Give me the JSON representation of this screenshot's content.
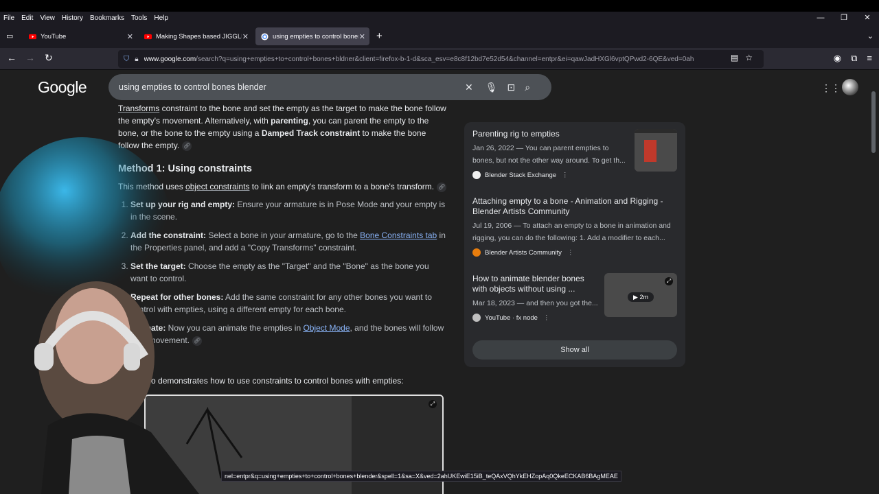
{
  "menu": [
    "File",
    "Edit",
    "View",
    "History",
    "Bookmarks",
    "Tools",
    "Help"
  ],
  "tabs": [
    {
      "label": "YouTube",
      "icon": "youtube-icon"
    },
    {
      "label": "Making Shapes based JIGGLE C",
      "icon": "youtube-icon"
    },
    {
      "label": "using empties to control bones",
      "icon": "google-icon"
    }
  ],
  "url": {
    "domain": "www.google.com",
    "rest": "/search?q=using+empties+to+control+bones+bldner&client=firefox-b-1-d&sca_esv=e8c8f12bd7e52d54&channel=entpr&ei=qawJadHXGl6vptQPwd2-6QE&ved=0ah"
  },
  "google": {
    "logo": "Google",
    "query": "using empties to control bones blender"
  },
  "article": {
    "intro_transforms": "Transforms",
    "intro_1": " constraint to the bone and set the empty as the target to make the bone follow the empty's movement. Alternatively, with ",
    "intro_parenting": "parenting",
    "intro_2": ", you can parent the empty to the bone, or the bone to the empty using a ",
    "intro_damped": "Damped Track constraint",
    "intro_3": " to make the bone follow the empty.",
    "method_heading": "Method 1: Using constraints",
    "method_1": "This method uses ",
    "method_link": "object constraints",
    "method_2": " to link an empty's transform to a bone's transform.",
    "steps": [
      {
        "bold": "Set up your rig and empty:",
        "text": " Ensure your armature is in Pose Mode and your empty is in the scene."
      },
      {
        "bold": "Add the constraint:",
        "text_a": " Select a bone in your armature, go to the ",
        "link": "Bone Constraints tab",
        "text_b": " in the Properties panel, and add a \"Copy Transforms\" constraint."
      },
      {
        "bold": "Set the target:",
        "text": " Choose the empty as the \"Target\" and the \"Bone\" as the bone you want to control."
      },
      {
        "bold": "Repeat for other bones:",
        "text": " Add the same constraint for any other bones you want to control with empties, using a different empty for each bone."
      },
      {
        "bold": "Animate:",
        "text_a": " Now you can animate the empties in ",
        "link": "Object Mode",
        "text_b": ", and the bones will follow their movement."
      }
    ],
    "video_line": "This video demonstrates how to use constraints to control bones with empties:"
  },
  "sidebar": {
    "cards": [
      {
        "title": "Parenting rig to empties",
        "desc": "Jan 26, 2022 — You can parent empties to bones, but not the other way around. To get th...",
        "source": "Blender Stack Exchange"
      },
      {
        "title": "Attaching empty to a bone - Animation and Rigging - Blender Artists Community",
        "desc": "Jul 19, 2006 — To attach an empty to a bone in animation and rigging, you can do the following: 1. Add a modifier to each...",
        "source": "Blender Artists Community"
      },
      {
        "title": "How to animate blender bones with objects without using ...",
        "desc": "Mar 18, 2023 — and then you got the...",
        "source": "YouTube · fx node",
        "duration": "2m"
      }
    ],
    "show_all": "Show all"
  },
  "status_url": "nel=entpr&q=using+empties+to+control+bones+blender&spell=1&sa=X&ved=2ahUKEwiE15iB_teQAxVQhYkEHZopAq0QkeECKAB6BAgMEAE",
  "colors": {
    "link": "#8ab4f8",
    "page_bg": "#1f1f1f",
    "card_bg": "#292a2d"
  }
}
